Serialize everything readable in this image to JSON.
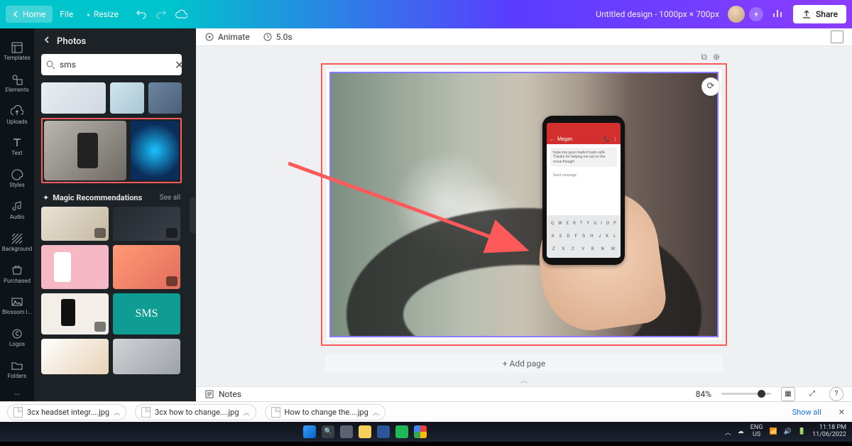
{
  "topbar": {
    "home_label": "Home",
    "file_label": "File",
    "resize_label": "Resize",
    "doc_title": "Untitled design - 1000px × 700px",
    "share_label": "Share"
  },
  "rail": {
    "items": [
      {
        "label": "Templates"
      },
      {
        "label": "Elements"
      },
      {
        "label": "Uploads"
      },
      {
        "label": "Text"
      },
      {
        "label": "Styles"
      },
      {
        "label": "Audio"
      },
      {
        "label": "Background"
      },
      {
        "label": "Purchased"
      },
      {
        "label": "Blossom I..."
      },
      {
        "label": "Logos"
      },
      {
        "label": "Folders"
      }
    ]
  },
  "sidebar": {
    "title": "Photos",
    "search_value": "sms",
    "magic_heading": "Magic Recommendations",
    "see_all": "See all",
    "sms_tile_text": "SMS"
  },
  "phone": {
    "contact_name": "Megan",
    "message_preview": "hope you guys made it back safe. Thanks for helping me out on the move though!",
    "input_hint": "Send message",
    "key_rows": [
      [
        "Q",
        "W",
        "E",
        "R",
        "T",
        "Y",
        "U",
        "I",
        "O",
        "P"
      ],
      [
        "A",
        "S",
        "D",
        "F",
        "G",
        "H",
        "J",
        "K",
        "L"
      ],
      [
        "Z",
        "X",
        "C",
        "V",
        "B",
        "N",
        "M"
      ]
    ]
  },
  "canvas_toolbar": {
    "animate": "Animate",
    "duration": "5.0s"
  },
  "addpage_label": "+ Add page",
  "bottombar": {
    "notes": "Notes",
    "zoom": "84%"
  },
  "downloads": {
    "items": [
      {
        "name": "3cx headset integr....jpg"
      },
      {
        "name": "3cx how to change....jpg"
      },
      {
        "name": "How to change the....jpg"
      }
    ],
    "show_all": "Show all"
  },
  "taskbar": {
    "lang_top": "ENG",
    "lang_bottom": "US",
    "time": "11:18 PM",
    "date": "11/06/2022"
  }
}
